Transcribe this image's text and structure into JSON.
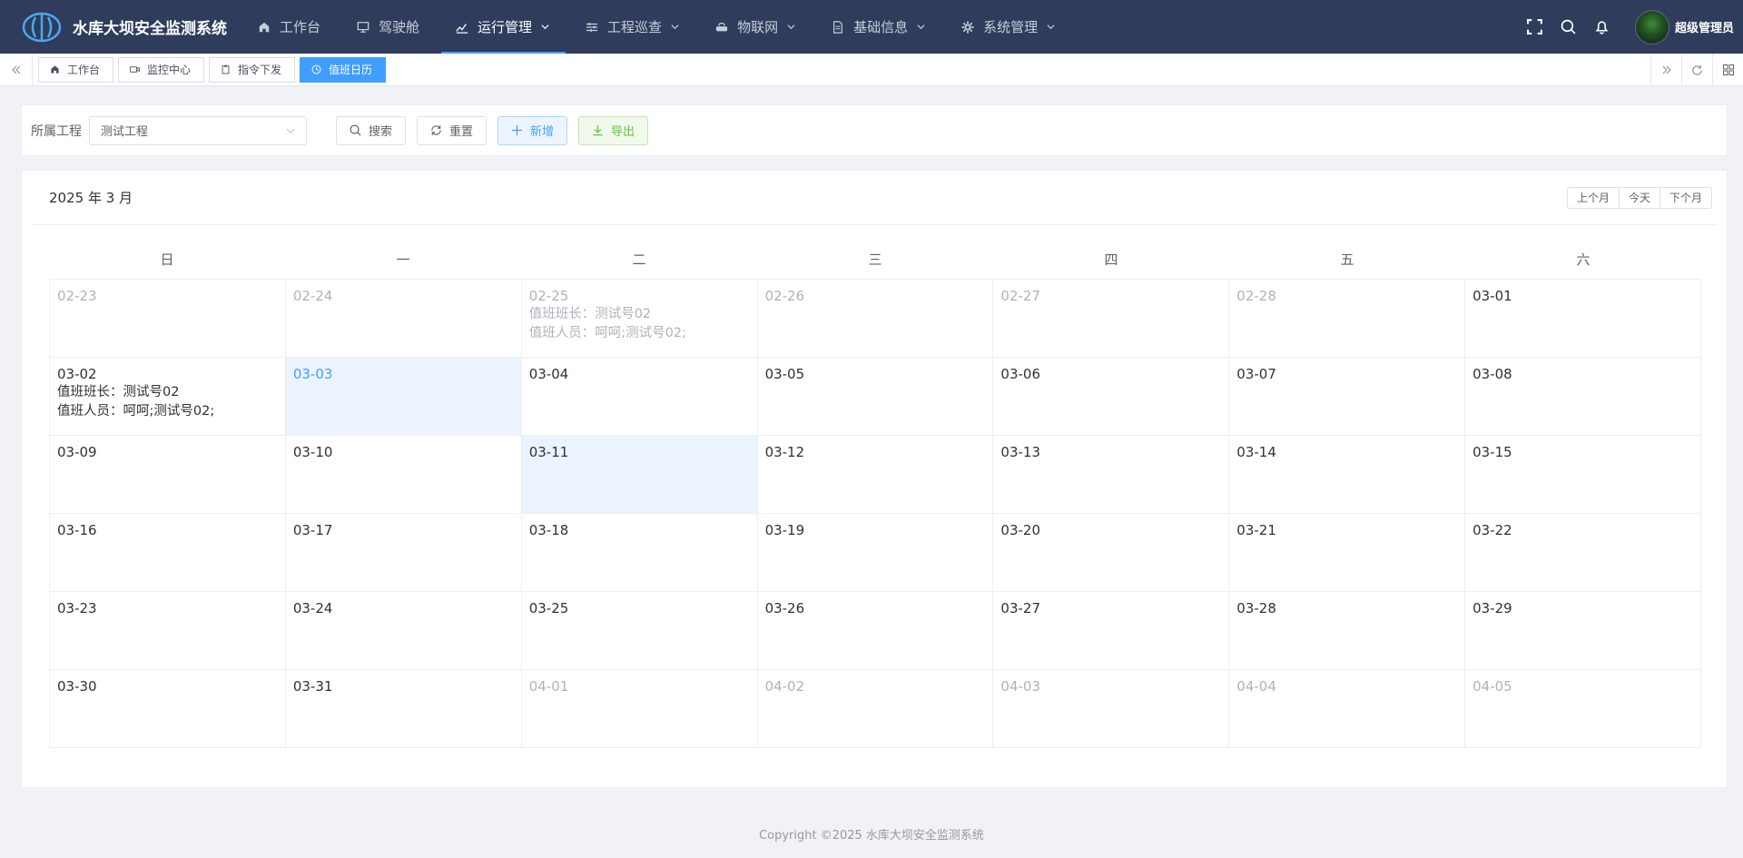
{
  "app": {
    "title": "水库大坝安全监测系统"
  },
  "nav": {
    "items": [
      {
        "label": "工作台",
        "icon": "home-icon",
        "dropdown": false,
        "active": false
      },
      {
        "label": "驾驶舱",
        "icon": "monitor-icon",
        "dropdown": false,
        "active": false
      },
      {
        "label": "运行管理",
        "icon": "chart-icon",
        "dropdown": true,
        "active": true
      },
      {
        "label": "工程巡查",
        "icon": "sliders-icon",
        "dropdown": true,
        "active": false
      },
      {
        "label": "物联网",
        "icon": "router-icon",
        "dropdown": true,
        "active": false
      },
      {
        "label": "基础信息",
        "icon": "document-icon",
        "dropdown": true,
        "active": false
      },
      {
        "label": "系统管理",
        "icon": "gear-icon",
        "dropdown": true,
        "active": false
      }
    ]
  },
  "user": {
    "name": "超级管理员"
  },
  "tags": [
    {
      "label": "工作台",
      "icon": "home-icon",
      "active": false
    },
    {
      "label": "监控中心",
      "icon": "camera-icon",
      "active": false
    },
    {
      "label": "指令下发",
      "icon": "clipboard-icon",
      "active": false
    },
    {
      "label": "值班日历",
      "icon": "clock-icon",
      "active": true
    }
  ],
  "search": {
    "project_label": "所属工程",
    "project_value": "测试工程",
    "search_btn": "搜索",
    "reset_btn": "重置",
    "add_btn": "新增",
    "export_btn": "导出"
  },
  "calendar": {
    "title": "2025 年 3 月",
    "prev_btn": "上个月",
    "today_btn": "今天",
    "next_btn": "下个月",
    "weekdays": [
      "日",
      "一",
      "二",
      "三",
      "四",
      "五",
      "六"
    ],
    "weeks": [
      [
        {
          "date": "02-23",
          "current": false
        },
        {
          "date": "02-24",
          "current": false
        },
        {
          "date": "02-25",
          "current": false,
          "notes": [
            "值班班长：测试号02",
            "值班人员：呵呵;测试号02;"
          ]
        },
        {
          "date": "02-26",
          "current": false
        },
        {
          "date": "02-27",
          "current": false
        },
        {
          "date": "02-28",
          "current": false
        },
        {
          "date": "03-01",
          "current": true
        }
      ],
      [
        {
          "date": "03-02",
          "current": true,
          "notes": [
            "值班班长：测试号02",
            "值班人员：呵呵;测试号02;"
          ]
        },
        {
          "date": "03-03",
          "current": true,
          "today": true,
          "selected": true
        },
        {
          "date": "03-04",
          "current": true
        },
        {
          "date": "03-05",
          "current": true
        },
        {
          "date": "03-06",
          "current": true
        },
        {
          "date": "03-07",
          "current": true
        },
        {
          "date": "03-08",
          "current": true
        }
      ],
      [
        {
          "date": "03-09",
          "current": true
        },
        {
          "date": "03-10",
          "current": true
        },
        {
          "date": "03-11",
          "current": true,
          "selected": true
        },
        {
          "date": "03-12",
          "current": true
        },
        {
          "date": "03-13",
          "current": true
        },
        {
          "date": "03-14",
          "current": true
        },
        {
          "date": "03-15",
          "current": true
        }
      ],
      [
        {
          "date": "03-16",
          "current": true
        },
        {
          "date": "03-17",
          "current": true
        },
        {
          "date": "03-18",
          "current": true
        },
        {
          "date": "03-19",
          "current": true
        },
        {
          "date": "03-20",
          "current": true
        },
        {
          "date": "03-21",
          "current": true
        },
        {
          "date": "03-22",
          "current": true
        }
      ],
      [
        {
          "date": "03-23",
          "current": true
        },
        {
          "date": "03-24",
          "current": true
        },
        {
          "date": "03-25",
          "current": true
        },
        {
          "date": "03-26",
          "current": true
        },
        {
          "date": "03-27",
          "current": true
        },
        {
          "date": "03-28",
          "current": true
        },
        {
          "date": "03-29",
          "current": true
        }
      ],
      [
        {
          "date": "03-30",
          "current": true
        },
        {
          "date": "03-31",
          "current": true
        },
        {
          "date": "04-01",
          "current": false
        },
        {
          "date": "04-02",
          "current": false
        },
        {
          "date": "04-03",
          "current": false
        },
        {
          "date": "04-04",
          "current": false
        },
        {
          "date": "04-05",
          "current": false
        }
      ]
    ]
  },
  "footer": {
    "copyright": "Copyright ©2025 水库大坝安全监测系统"
  },
  "colors": {
    "nav_bg": "#2f3c5b",
    "accent": "#409eff",
    "success": "#67c23a",
    "selected_bg": "#ebf4fe"
  }
}
